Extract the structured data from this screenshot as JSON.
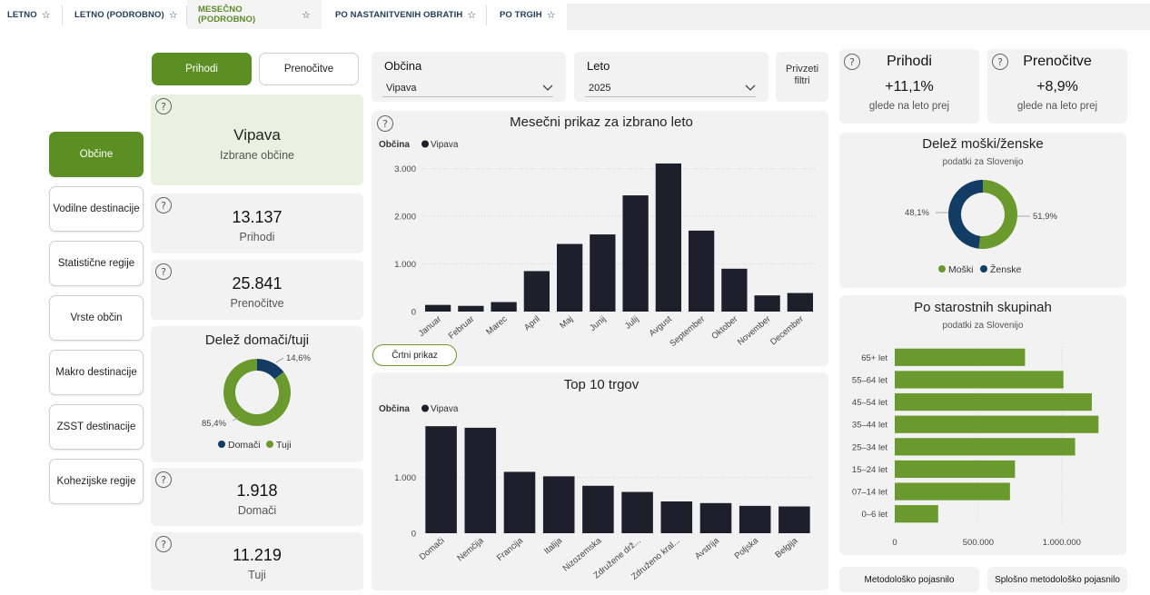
{
  "tabs": [
    {
      "label": "LETNO"
    },
    {
      "label": "LETNO (PODROBNO)"
    },
    {
      "label": "MESEČNO (PODROBNO)"
    },
    {
      "label": "PO NASTANITVENIH OBRATIH"
    },
    {
      "label": "PO TRGIH"
    }
  ],
  "star_glyph": "☆",
  "nav": [
    {
      "label": "Občine"
    },
    {
      "label": "Vodilne destinacije"
    },
    {
      "label": "Statistične regije"
    },
    {
      "label": "Vrste občin"
    },
    {
      "label": "Makro destinacije"
    },
    {
      "label": "ZSST destinacije"
    },
    {
      "label": "Kohezijske regije"
    }
  ],
  "toggle": {
    "prihodi": "Prihodi",
    "prenocitve": "Prenočitve"
  },
  "help_glyph": "?",
  "selection": {
    "name": "Vipava",
    "caption": "Izbrane občine"
  },
  "kpi": {
    "prihodi_value": "13.137",
    "prihodi_label": "Prihodi",
    "prenocitve_value": "25.841",
    "prenocitve_label": "Prenočitve",
    "domaci_value": "1.918",
    "domaci_label": "Domači",
    "tuji_value": "11.219",
    "tuji_label": "Tuji"
  },
  "filters": {
    "obcina_label": "Občina",
    "obcina_value": "Vipava",
    "leto_label": "Leto",
    "leto_value": "2025",
    "reset_label_1": "Privzeti",
    "reset_label_2": "filtri"
  },
  "change": {
    "prihodi_title": "Prihodi",
    "prihodi_value": "+11,1%",
    "prihodi_caption": "glede na leto prej",
    "prenocitve_title": "Prenočitve",
    "prenocitve_value": "+8,9%",
    "prenocitve_caption": "glede na leto prej"
  },
  "buttons": {
    "line_view": "Črtni prikaz",
    "method": "Metodološko pojasnilo",
    "general_method": "Splošno metodološko pojasnilo"
  },
  "colors": {
    "green": "#6a9a2e",
    "navy": "#123c63",
    "bar": "#1e1f2a",
    "nav_active": "#5b8f23"
  },
  "chart_data": [
    {
      "type": "pie",
      "title": "Delež domači/tuji",
      "labels": [
        "Domači",
        "Tuji"
      ],
      "values": [
        14.6,
        85.4
      ],
      "value_labels": [
        "14,6%",
        "85,4%"
      ],
      "legend": "bottom"
    },
    {
      "type": "bar",
      "title": "Mesečni prikaz za izbrano leto",
      "legend_title": "Občina",
      "series": [
        {
          "name": "Vipava",
          "values": [
            140,
            120,
            200,
            850,
            1420,
            1620,
            2440,
            3110,
            1700,
            900,
            340,
            390
          ]
        }
      ],
      "categories": [
        "Januar",
        "Februar",
        "Marec",
        "April",
        "Maj",
        "Junij",
        "Julij",
        "Avgust",
        "September",
        "Oktober",
        "November",
        "December"
      ],
      "y_ticks": [
        0,
        1000,
        2000,
        3000
      ],
      "y_tick_labels": [
        "0",
        "1.000",
        "2.000",
        "3.000"
      ],
      "ylim": [
        0,
        3300
      ],
      "grid": true
    },
    {
      "type": "bar",
      "title": "Top 10 trgov",
      "legend_title": "Občina",
      "series": [
        {
          "name": "Vipava",
          "values": [
            1918,
            1890,
            1100,
            1020,
            850,
            740,
            570,
            540,
            490,
            480
          ]
        }
      ],
      "categories": [
        "Domači",
        "Nemčija",
        "Francija",
        "Italija",
        "Nizozemska",
        "Združene drž...",
        "Združeno kral...",
        "Avstrija",
        "Poljska",
        "Belgija"
      ],
      "y_ticks": [
        0,
        1000
      ],
      "y_tick_labels": [
        "0",
        "1.000"
      ],
      "ylim": [
        0,
        2100
      ],
      "grid": true
    },
    {
      "type": "pie",
      "title": "Delež moški/ženske",
      "subtitle": "podatki za Slovenijo",
      "labels": [
        "Moški",
        "Ženske"
      ],
      "values": [
        51.9,
        48.1
      ],
      "value_labels": [
        "51,9%",
        "48,1%"
      ],
      "legend": "bottom"
    },
    {
      "type": "bar",
      "orientation": "horizontal",
      "title": "Po starostnih skupinah",
      "subtitle": "podatki za Slovenijo",
      "categories": [
        "65+ let",
        "55–64 let",
        "45–54 let",
        "35–44 let",
        "25–34 let",
        "15–24 let",
        "07–14 let",
        "0–6 let"
      ],
      "values": [
        780000,
        1010000,
        1180000,
        1220000,
        1080000,
        720000,
        690000,
        260000
      ],
      "x_ticks": [
        0,
        500000,
        1000000
      ],
      "x_tick_labels": [
        "0",
        "500.000",
        "1.000.000"
      ],
      "xlim": [
        0,
        1300000
      ]
    }
  ]
}
